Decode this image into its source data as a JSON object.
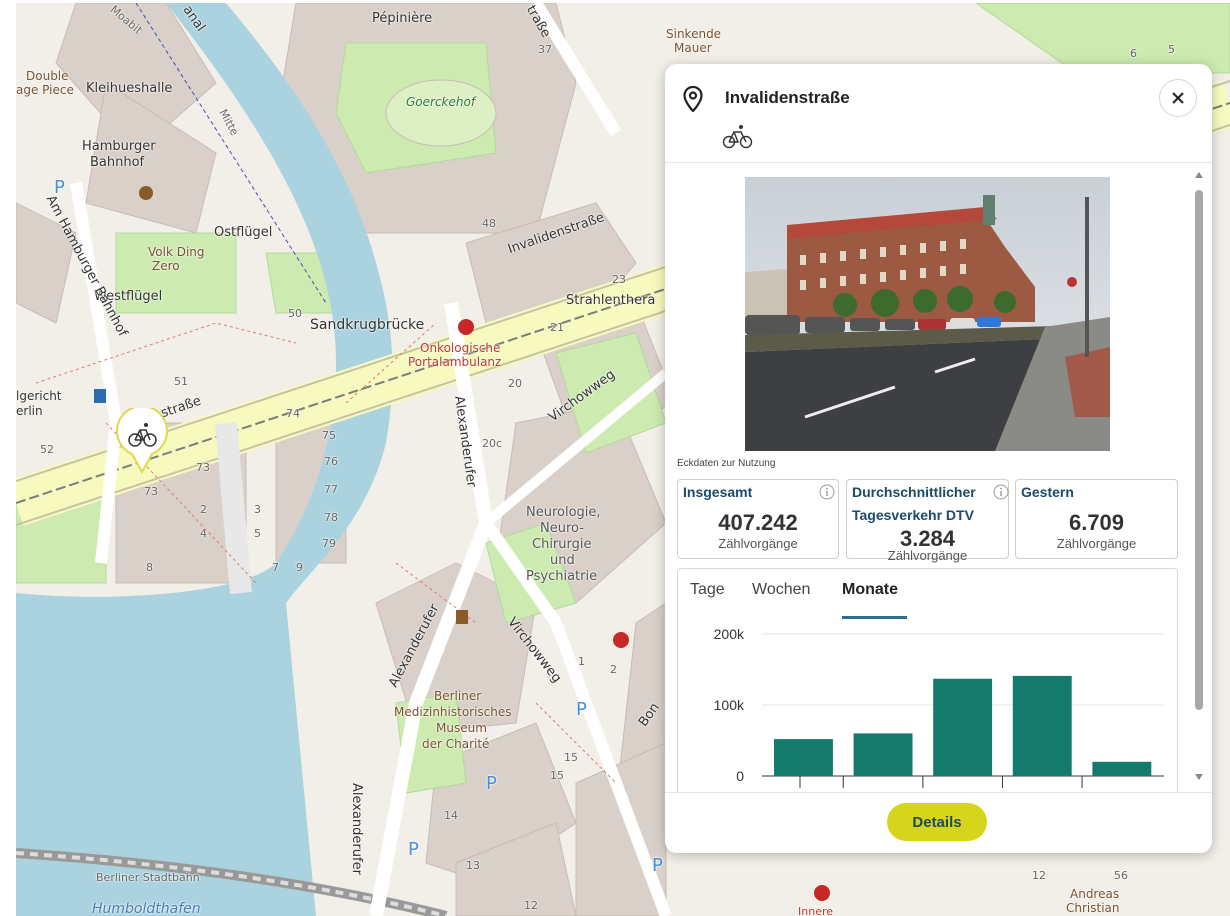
{
  "map": {
    "labels": {
      "pepiniere": "Pépinière",
      "sinkende": "Sinkende",
      "mauer": "Mauer",
      "goerckehof": "Goerckehof",
      "double": "Double",
      "age_piece": "age Piece",
      "kleihueshalle": "Kleihueshalle",
      "hamburger": "Hamburger",
      "bahnhof": "Bahnhof",
      "ostfluegel": "Ostflügel",
      "volk_ding": "Volk Ding",
      "zero": "Zero",
      "westfluegel": "Westflügel",
      "sandkrugbruecke": "Sandkrugbrücke",
      "onkologische": "Onkologische",
      "portalambulanz": "Portalambulanz",
      "strahlenthera": "Strahlenthera",
      "invalidenstrasse": "Invalidenstraße",
      "denstrasse": "denstraße",
      "am_hamburger_bahnhof": "Am Hamburger Bahnhof",
      "alexanderufer": "Alexanderufer",
      "virchowweg": "Virchowweg",
      "neurologie": "Neurologie,",
      "neuro": "Neuro-",
      "chirurgie": "Chirurgie",
      "und": "und",
      "psychiatrie": "Psychiatrie",
      "berliner": "Berliner",
      "medizinhist": "Medizinhistorisches",
      "museum": "Museum",
      "der_charite": "der Charité",
      "berliner_stadtbahn": "Berliner Stadtbahn",
      "humboldthafen": "Humboldthafen",
      "moabit": "Moabit",
      "mitte": "Mitte",
      "kanal": "anal",
      "strasse_top": "traße",
      "gericht": "lgericht",
      "erlin": "erlin",
      "innere": "Innere",
      "andreas": "Andreas",
      "christian": "Christian",
      "bon": "Bon",
      "n48": "48",
      "n50": "50",
      "n51": "51",
      "n52": "52",
      "n73a": "73",
      "n73b": "73",
      "n74": "74",
      "n75": "75",
      "n76": "76",
      "n77": "77",
      "n78": "78",
      "n79": "79",
      "n2": "2",
      "n3": "3",
      "n4": "4",
      "n5": "5",
      "n7": "7",
      "n8": "8",
      "n9": "9",
      "n23": "23",
      "n21": "21",
      "n20": "20",
      "n20c": "20c",
      "n37": "37",
      "n1": "1",
      "n2b": "2",
      "n15a": "15",
      "n15b": "15",
      "n14": "14",
      "n13": "13",
      "n12a": "12",
      "n12b": "12",
      "n56": "56",
      "n6": "6",
      "n5b": "5",
      "p": "P"
    }
  },
  "panel": {
    "title": "Invalidenstraße",
    "close_icon": "close-icon",
    "mode_icon": "bicycle-icon",
    "section_label": "Eckdaten zur Nutzung",
    "stats": [
      {
        "label": "Insgesamt",
        "value": "407.242",
        "unit": "Zählvorgänge"
      },
      {
        "label_line1": "Durchschnittlicher",
        "label_line2": "Tagesverkehr DTV",
        "value": "3.284",
        "unit": "Zählvorgänge"
      },
      {
        "label": "Gestern",
        "value": "6.709",
        "unit": "Zählvorgänge"
      }
    ],
    "tabs": [
      "Tage",
      "Wochen",
      "Monate"
    ],
    "active_tab": "Monate",
    "details_label": "Details"
  },
  "chart_data": {
    "type": "bar",
    "yticks": [
      "200k",
      "100k",
      "0"
    ],
    "ylim": [
      0,
      200000
    ],
    "values": [
      52000,
      60000,
      137000,
      141000,
      20000
    ],
    "color": "#137a6c"
  },
  "colors": {
    "accent_button": "#d7d51b",
    "bar": "#137a6c",
    "tab_underline": "#2f6f8a",
    "stat_label": "#1b4a6b"
  }
}
